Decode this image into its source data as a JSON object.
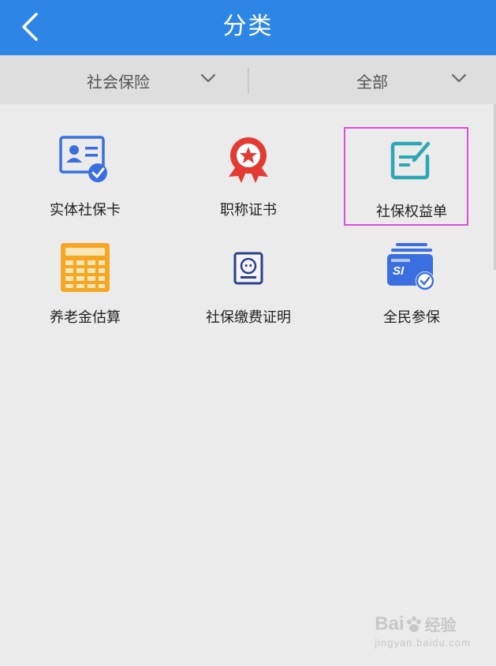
{
  "header": {
    "title": "分类",
    "back_icon": "chevron-left-icon",
    "background_color": "#2d86e6"
  },
  "filters": {
    "category": "社会保险",
    "scope": "全部",
    "dropdown_icon": "chevron-down-icon"
  },
  "items": [
    {
      "label": "实体社保卡",
      "icon": "id-card-check-icon"
    },
    {
      "label": "职称证书",
      "icon": "award-ribbon-icon"
    },
    {
      "label": "社保权益单",
      "icon": "edit-document-icon"
    },
    {
      "label": "养老金估算",
      "icon": "calculator-icon"
    },
    {
      "label": "社保缴费证明",
      "icon": "certificate-icon"
    },
    {
      "label": "全民参保",
      "icon": "si-card-check-icon"
    }
  ],
  "highlight_color": "#d94fd8",
  "watermark": {
    "brand": "Bai",
    "brand_suffix": "经验",
    "url": "jingyan.baidu.com"
  }
}
